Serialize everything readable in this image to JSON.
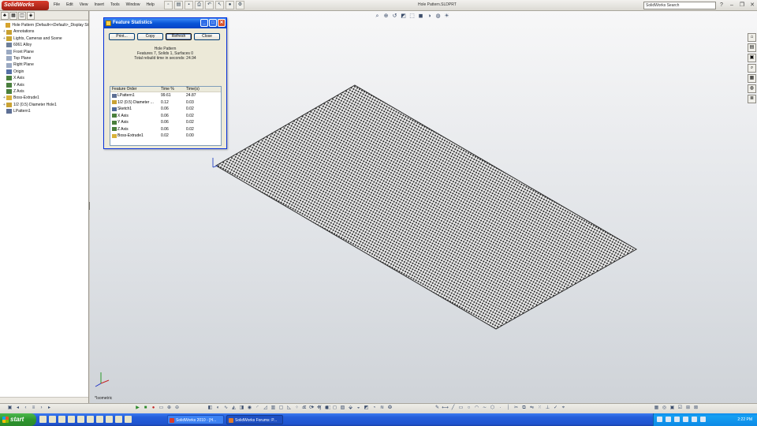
{
  "app": {
    "logo_text": "SolidWorks",
    "menus": [
      "File",
      "Edit",
      "View",
      "Insert",
      "Tools",
      "Window",
      "Help"
    ],
    "document_title": "Hole Pattern.SLDPRT",
    "search_placeholder": "SolidWorks Search",
    "help_glyph": "?"
  },
  "feature_manager": {
    "tabs": [
      "feature-manager-tab",
      "property-manager-tab",
      "configuration-manager-tab",
      "dimxpert-tab"
    ],
    "tree": [
      {
        "label": "Hole Pattern (Default<<Default>_Display St",
        "level": 0,
        "expand": "",
        "icon": "part-icon",
        "color": "#d6a42e"
      },
      {
        "label": "Annotations",
        "level": 1,
        "expand": "+",
        "icon": "annotations-icon",
        "color": "#c8a030"
      },
      {
        "label": "Lights, Cameras and Scene",
        "level": 1,
        "expand": "+",
        "icon": "lights-icon",
        "color": "#caa532"
      },
      {
        "label": "6061 Alloy",
        "level": 1,
        "expand": "",
        "icon": "material-icon",
        "color": "#6d7f9a"
      },
      {
        "label": "Front Plane",
        "level": 1,
        "expand": "",
        "icon": "plane-icon",
        "color": "#9aa9c2"
      },
      {
        "label": "Top Plane",
        "level": 1,
        "expand": "",
        "icon": "plane-icon",
        "color": "#9aa9c2"
      },
      {
        "label": "Right Plane",
        "level": 1,
        "expand": "",
        "icon": "plane-icon",
        "color": "#9aa9c2"
      },
      {
        "label": "Origin",
        "level": 1,
        "expand": "",
        "icon": "origin-icon",
        "color": "#5570a6"
      },
      {
        "label": "X Axis",
        "level": 1,
        "expand": "",
        "icon": "axis-icon",
        "color": "#4a7f3d"
      },
      {
        "label": "Y Axis",
        "level": 1,
        "expand": "",
        "icon": "axis-icon",
        "color": "#4a7f3d"
      },
      {
        "label": "Z Axis",
        "level": 1,
        "expand": "",
        "icon": "axis-icon",
        "color": "#4a7f3d"
      },
      {
        "label": "Boss-Extrude1",
        "level": 1,
        "expand": "+",
        "icon": "extrude-icon",
        "color": "#d8b23a"
      },
      {
        "label": "1/2 (0.5) Diameter Hole1",
        "level": 1,
        "expand": "+",
        "icon": "hole-icon",
        "color": "#c9a233"
      },
      {
        "label": "LPattern1",
        "level": 1,
        "expand": "",
        "icon": "pattern-icon",
        "color": "#5d6f94"
      }
    ]
  },
  "viewport": {
    "view_label": "*Isometric",
    "heads_up_icons": [
      "zoom-fit-icon",
      "zoom-area-icon",
      "previous-view-icon",
      "section-view-icon",
      "view-orientation-icon",
      "display-style-icon",
      "hide-show-icon",
      "edit-appearance-icon",
      "apply-scene-icon"
    ],
    "taskpane_icons": [
      "resources-icon",
      "design-library-icon",
      "file-explorer-icon",
      "search-results-icon",
      "view-palette-icon",
      "appearances-icon",
      "custom-properties-icon"
    ],
    "plate_color": "#2b2b2b",
    "background_top": "#f7f7f8",
    "background_bottom": "#cfd3d8"
  },
  "dialog": {
    "title": "Feature Statistics",
    "buttons": {
      "print": "Print...",
      "copy": "Copy",
      "refresh": "Refresh",
      "close": "Close"
    },
    "part_name": "Hole Pattern",
    "summary": "Features 7, Solids 1, Surfaces 0",
    "rebuild_time": "Total rebuild time in seconds: 24.94",
    "columns": [
      "Feature Order",
      "Time %",
      "Time(s)"
    ],
    "rows": [
      {
        "feature": "LPattern1",
        "pct": "99.61",
        "time": "24.87",
        "icon": "pattern-icon",
        "color": "#5d6f94"
      },
      {
        "feature": "1/2 (0.5) Diameter ...",
        "pct": "0.12",
        "time": "0.03",
        "icon": "hole-icon",
        "color": "#c9a233"
      },
      {
        "feature": "Sketch1",
        "pct": "0.06",
        "time": "0.02",
        "icon": "sketch-icon",
        "color": "#4f6a9a"
      },
      {
        "feature": "X Axis",
        "pct": "0.06",
        "time": "0.02",
        "icon": "axis-icon",
        "color": "#4a7f3d"
      },
      {
        "feature": "Y Axis",
        "pct": "0.06",
        "time": "0.02",
        "icon": "axis-icon",
        "color": "#4a7f3d"
      },
      {
        "feature": "Z Axis",
        "pct": "0.06",
        "time": "0.02",
        "icon": "axis-icon",
        "color": "#4a7f3d"
      },
      {
        "feature": "Boss-Extrude1",
        "pct": "0.02",
        "time": "0.00",
        "icon": "extrude-icon",
        "color": "#d8b23a"
      }
    ]
  },
  "taskbar": {
    "start_label": "start",
    "quicklaunch": [
      "ie-icon",
      "explorer-icon",
      "media-icon",
      "outlook-icon",
      "word-icon",
      "excel-icon",
      "powerpoint-icon",
      "acrobat-icon",
      "calc-icon",
      "paint-icon"
    ],
    "tasks": [
      {
        "label": "SolidWorks 2010 - [H..."
      },
      {
        "label": "SolidWorks Forums: P..."
      }
    ],
    "clock": "2:22 PM"
  }
}
